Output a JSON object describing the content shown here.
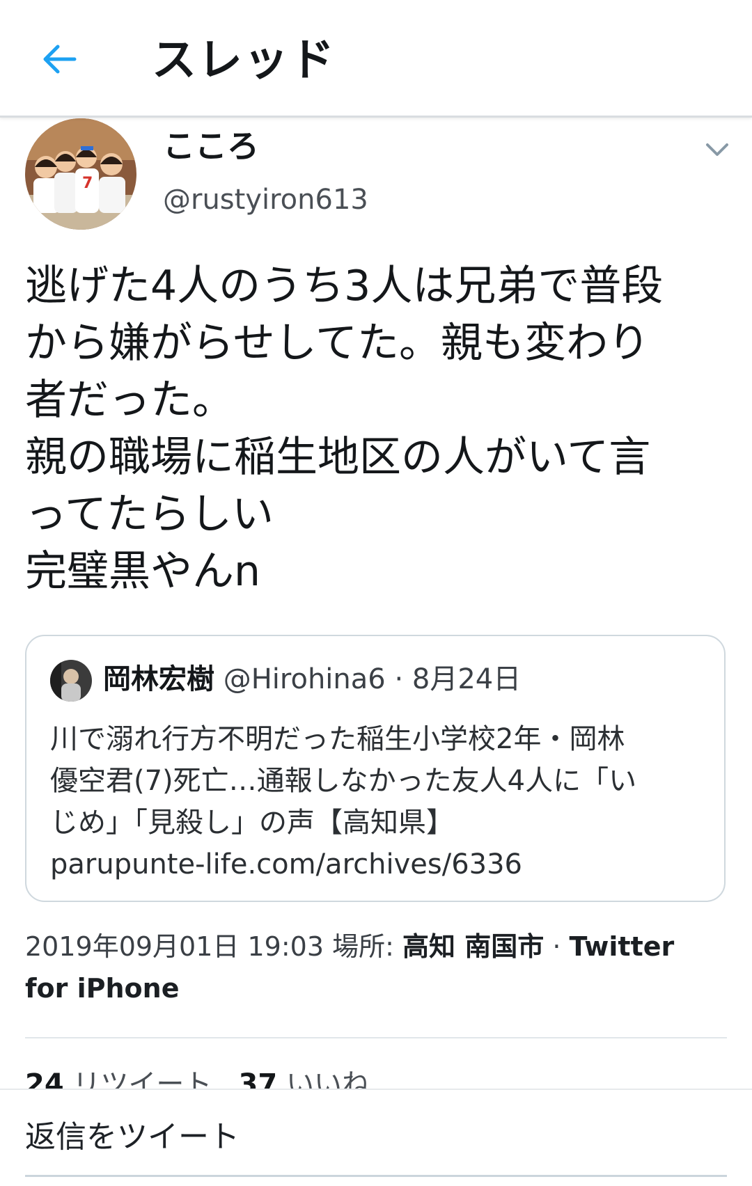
{
  "header": {
    "back_icon": "arrow-left-icon",
    "title": "スレッド",
    "accent_color": "#1da1f2"
  },
  "tweet": {
    "display_name": "こころ",
    "username": "@rustyiron613",
    "caret_icon": "chevron-down-icon",
    "text_lines": [
      "逃げた4人のうち3人は兄弟で普段",
      "から嫌がらせしてた。親も変わり",
      "者だった。",
      "親の職場に稲生地区の人がいて言",
      "ってたらしい",
      "完璧黒やんn"
    ]
  },
  "quote": {
    "display_name": "岡林宏樹",
    "username": "@Hirohina6",
    "date": "· 8月24日",
    "text_lines": [
      "川で溺れ行方不明だった稲生小学校2年・岡林",
      "優空君(7)死亡…通報しなかった友人4人に「い",
      "じめ」「見殺し」の声【高知県】",
      "parupunte-life.com/archives/6336"
    ]
  },
  "meta": {
    "timestamp": "2019年09月01日 19:03",
    "location_label": "場所:",
    "location": "高知 南国市",
    "separator": "·",
    "source_part1": "Twitter",
    "source_part2": "for iPhone"
  },
  "stats": {
    "retweets_count": "24",
    "retweets_label": "リツイート",
    "likes_count": "37",
    "likes_label": "いいね"
  },
  "reply": {
    "placeholder": "返信をツイート"
  }
}
